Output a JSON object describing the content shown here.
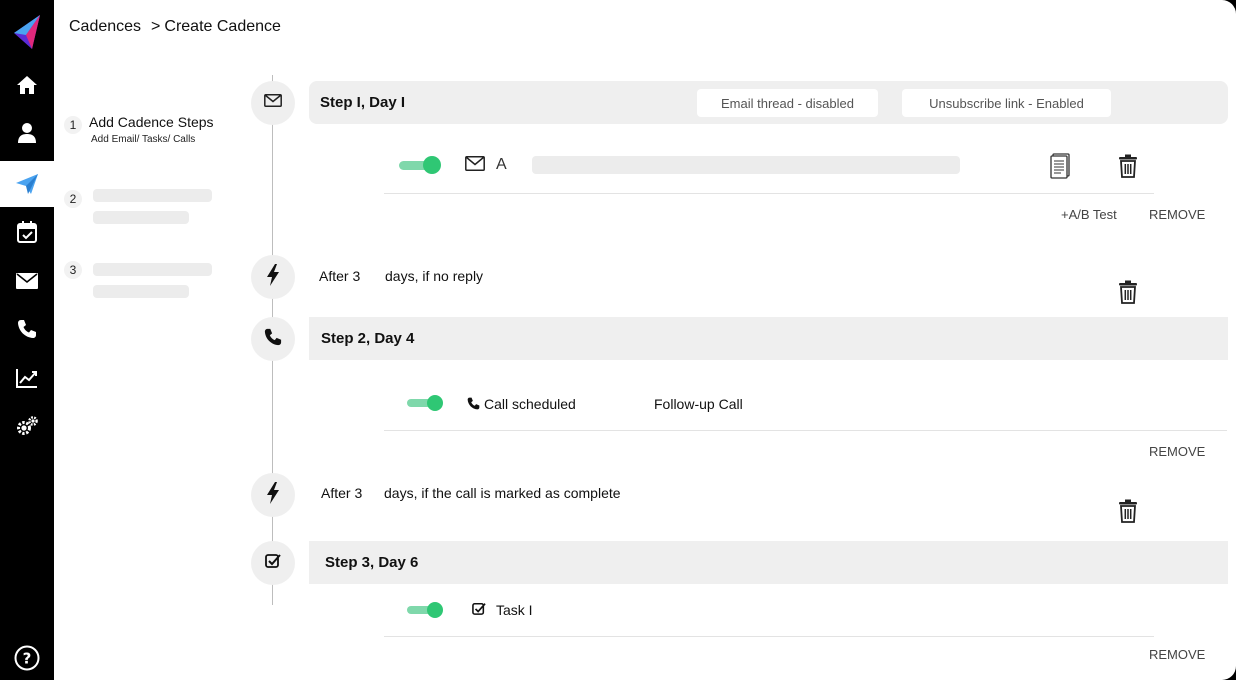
{
  "breadcrumb": {
    "parent": "Cadences",
    "separator": ">",
    "current": "Create Cadence"
  },
  "wizard_steps": [
    {
      "number": "1",
      "title": "Add Cadence Steps",
      "subtitle": "Add Email/ Tasks/ Calls"
    },
    {
      "number": "2"
    },
    {
      "number": "3"
    }
  ],
  "sidebar": {
    "items": [
      {
        "icon": "logo-paper-plane-icon"
      },
      {
        "icon": "home-icon"
      },
      {
        "icon": "user-icon"
      },
      {
        "icon": "send-icon",
        "active": true
      },
      {
        "icon": "calendar-check-icon"
      },
      {
        "icon": "mail-icon"
      },
      {
        "icon": "phone-icon"
      },
      {
        "icon": "chart-line-icon"
      },
      {
        "icon": "gears-icon"
      },
      {
        "icon": "help-icon"
      }
    ]
  },
  "step1": {
    "title": "Step I, Day I",
    "email_thread": "Email thread - disabled",
    "unsubscribe": "Unsubscribe link - Enabled",
    "variant_label": "A",
    "ab_test": "+A/B Test",
    "remove": "REMOVE"
  },
  "delay1": {
    "after": "After 3",
    "condition": "days, if no reply"
  },
  "step2": {
    "title": "Step 2, Day 4",
    "call_status": "Call scheduled",
    "call_name": "Follow-up Call",
    "remove": "REMOVE"
  },
  "delay2": {
    "after": "After 3",
    "condition": "days, if the call is marked as complete"
  },
  "step3": {
    "title": "Step 3, Day 6",
    "task_name": "Task I",
    "remove": "REMOVE"
  },
  "colors": {
    "accent": "#2fc774",
    "accent_light": "#7fd8ab",
    "brand_blue": "#4aa3f0",
    "band_gray": "#efefef"
  }
}
